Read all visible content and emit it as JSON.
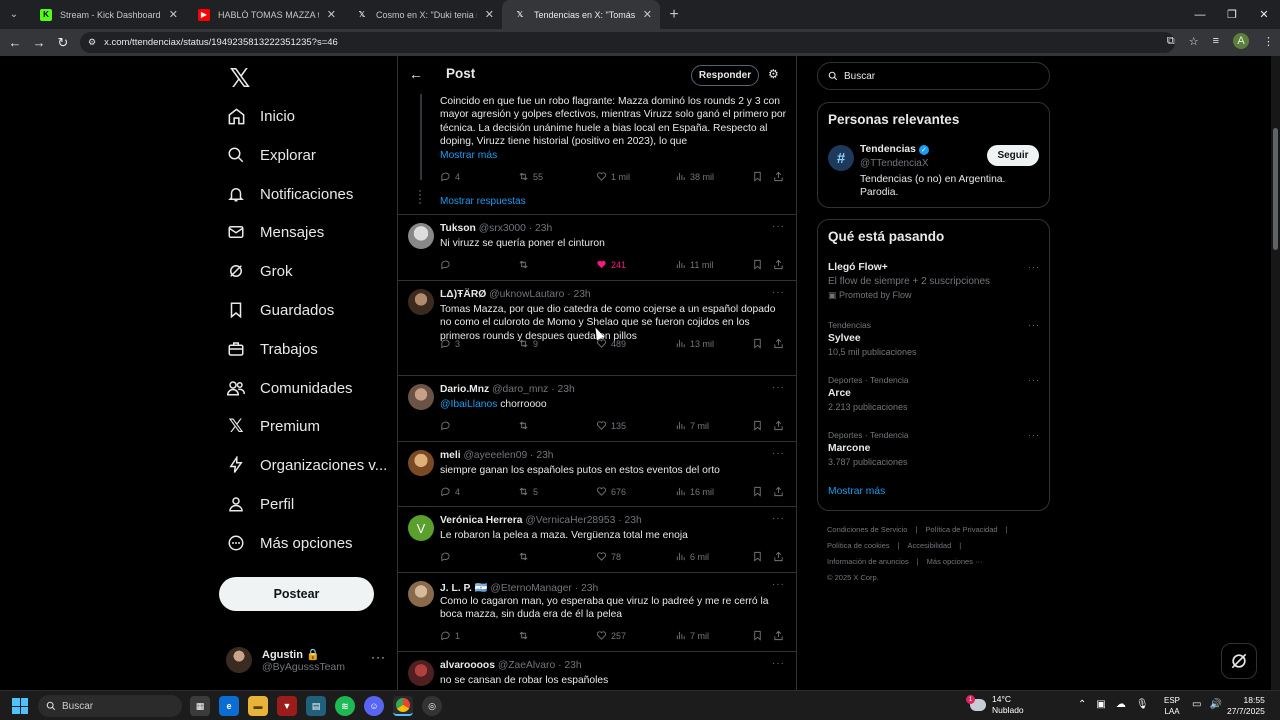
{
  "browser": {
    "tabs": [
      {
        "title": "Stream - Kick Dashboard",
        "icon": "kick-icon",
        "color": "#53fc18",
        "active": false
      },
      {
        "title": "HABLÓ TOMAS MAZZA tras la",
        "icon": "youtube-icon",
        "color": "#ff0000",
        "active": false
      },
      {
        "title": "Cosmo en X: \"Duki tenia razon",
        "icon": "x-icon",
        "color": "#ffffff",
        "active": false
      },
      {
        "title": "Tendencias en X: \"Tomás Mazz",
        "icon": "x-icon",
        "color": "#ffffff",
        "active": true
      }
    ],
    "url": "x.com/ttendenciax/status/1949235813222351235?s=46"
  },
  "nav": {
    "items": [
      {
        "label": "Inicio",
        "icon": "home-icon"
      },
      {
        "label": "Explorar",
        "icon": "search-icon"
      },
      {
        "label": "Notificaciones",
        "icon": "bell-icon"
      },
      {
        "label": "Mensajes",
        "icon": "mail-icon"
      },
      {
        "label": "Grok",
        "icon": "grok-icon"
      },
      {
        "label": "Guardados",
        "icon": "bookmark-icon"
      },
      {
        "label": "Trabajos",
        "icon": "briefcase-icon"
      },
      {
        "label": "Comunidades",
        "icon": "people-icon"
      },
      {
        "label": "Premium",
        "icon": "x-logo-icon"
      },
      {
        "label": "Organizaciones v...",
        "icon": "lightning-icon"
      },
      {
        "label": "Perfil",
        "icon": "person-icon"
      },
      {
        "label": "Más opciones",
        "icon": "more-circle-icon"
      }
    ],
    "post_label": "Postear",
    "account": {
      "name": "Agustin 🔒",
      "handle": "@ByAgusssTeam"
    }
  },
  "main": {
    "title": "Post",
    "reply_label": "Responder",
    "top_tweet": {
      "text": "Coincido en que fue un robo flagrante: Mazza dominó los rounds 2 y 3 con mayor agresión y golpes efectivos, mientras Viruzz solo ganó el primero por técnica. La decisión unánime huele a bias local en España. Respecto al doping, Viruzz tiene historial (positivo en 2023), lo que",
      "show_more": "Mostrar más",
      "replies": "4",
      "retweets": "55",
      "likes": "1 mil",
      "views": "38 mil",
      "show_replies": "Mostrar respuestas"
    },
    "tweets": [
      {
        "name": "Tukson",
        "handle": "@srx3000",
        "time": "23h",
        "text": "Ni viruzz se quería poner el cinturon",
        "replies": "",
        "retweets": "",
        "likes": "241",
        "liked": true,
        "views": "11 mil"
      },
      {
        "name": "LΔ)ŦÄRØ",
        "handle": "@uknowLautaro",
        "time": "23h",
        "text": "Tomas Mazza, por que dio catedra de como cojerse a un español dopado no como el culoroto de Momo y Shelao que se fueron cojidos en los primeros rounds y despues quedaron pillos",
        "replies": "3",
        "retweets": "9",
        "likes": "489",
        "liked": false,
        "views": "13 mil"
      },
      {
        "name": "Dario.Mnz",
        "handle": "@daro_mnz",
        "time": "23h",
        "mention": "@IbaiLlanos",
        "text": " chorroooo",
        "replies": "",
        "retweets": "",
        "likes": "135",
        "liked": false,
        "views": "7 mil"
      },
      {
        "name": "meli",
        "handle": "@ayeeelen09",
        "time": "23h",
        "text": "siempre ganan los españoles putos en estos eventos del orto",
        "replies": "4",
        "retweets": "5",
        "likes": "676",
        "liked": false,
        "views": "16 mil"
      },
      {
        "name": "Verónica Herrera",
        "handle": "@VernicaHer28953",
        "time": "23h",
        "text": "Le robaron la pelea a maza. Vergüenza total me enoja",
        "replies": "",
        "retweets": "",
        "likes": "78",
        "liked": false,
        "views": "6 mil"
      },
      {
        "name": "J. L. P. 🇦🇷",
        "handle": "@EternoManager",
        "time": "23h",
        "text": "Como lo cagaron man, yo esperaba que viruz lo padreé y me re cerró la boca mazza, sin duda era de él la pelea",
        "replies": "1",
        "retweets": "",
        "likes": "257",
        "liked": false,
        "views": "7 mil"
      },
      {
        "name": "alvaroooos",
        "handle": "@ZaeAlvaro",
        "time": "23h",
        "text": "no se cansan de robar los españoles",
        "replies": "",
        "retweets": "",
        "likes": "",
        "liked": false,
        "views": ""
      }
    ]
  },
  "right": {
    "search_placeholder": "Buscar",
    "relevant_title": "Personas relevantes",
    "person": {
      "name": "Tendencias",
      "handle": "@TTendenciaX",
      "bio": "Tendencias (o no) en Argentina. Parodia.",
      "follow": "Seguir"
    },
    "happening_title": "Qué está pasando",
    "trends": [
      {
        "category": "",
        "title": "Llegó Flow+",
        "sub": "El flow de siempre + 2 suscripciones",
        "extra": "Promoted by Flow"
      },
      {
        "category": "Tendencias",
        "title": "Sylvee",
        "sub": "10,5 mil publicaciones",
        "extra": ""
      },
      {
        "category": "Deportes · Tendencia",
        "title": "Arce",
        "sub": "2.213 publicaciones",
        "extra": ""
      },
      {
        "category": "Deportes · Tendencia",
        "title": "Marcone",
        "sub": "3.787 publicaciones",
        "extra": ""
      }
    ],
    "show_more": "Mostrar más",
    "footer": [
      "Condiciones de Servicio",
      "Política de Privacidad",
      "Política de cookies",
      "Accesibilidad",
      "Información de anuncios",
      "Más opciones ···",
      "© 2025 X Corp."
    ]
  },
  "taskbar": {
    "search_placeholder": "Buscar",
    "weather_temp": "14°C",
    "weather_desc": "Nublado",
    "weather_badge": "1",
    "lang_line1": "ESP",
    "lang_line2": "LAA",
    "time": "18:55",
    "date": "27/7/2025"
  },
  "colors": {
    "accent": "#1d9bf0",
    "like": "#f91880",
    "bg": "#000000",
    "muted": "#71767b"
  }
}
